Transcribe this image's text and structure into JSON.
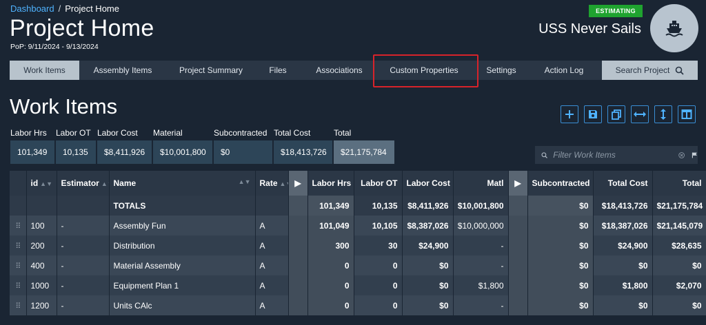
{
  "breadcrumb": {
    "home": "Dashboard",
    "separator": "/",
    "current": "Project Home"
  },
  "page": {
    "title": "Project Home",
    "pop": "PoP: 9/11/2024 - 9/13/2024"
  },
  "project": {
    "status": "ESTIMATING",
    "name": "USS Never Sails",
    "status_color": "#1fa32f",
    "avatar_icon": "ship-icon"
  },
  "tabs": [
    "Work Items",
    "Assembly Items",
    "Project Summary",
    "Files",
    "Associations",
    "Custom Properties",
    "Settings",
    "Action Log"
  ],
  "search_tab": {
    "label": "Search Project",
    "icon": "search-icon"
  },
  "section": {
    "title": "Work Items"
  },
  "toolbar": {
    "icons": [
      "add-icon",
      "save-icon",
      "copy-icon",
      "expand-horizontal-icon",
      "expand-vertical-icon",
      "columns-icon"
    ]
  },
  "summary": {
    "labels": [
      "Labor Hrs",
      "Labor OT",
      "Labor Cost",
      "Material",
      "Subcontracted",
      "Total Cost",
      "Total"
    ],
    "values": [
      "101,349",
      "10,135",
      "$8,411,926",
      "$10,001,800",
      "$0",
      "$18,413,726",
      "$21,175,784"
    ]
  },
  "filter": {
    "placeholder": "Filter Work Items"
  },
  "grid": {
    "headers": {
      "id": "id",
      "estimator": "Estimator",
      "name": "Name",
      "rate": "Rate",
      "labor_hrs": "Labor Hrs",
      "labor_ot": "Labor OT",
      "labor_cost": "Labor Cost",
      "matl": "Matl",
      "subcontracted": "Subcontracted",
      "total_cost": "Total Cost",
      "total": "Total"
    },
    "totals": {
      "label": "TOTALS",
      "labor_hrs": "101,349",
      "labor_ot": "10,135",
      "labor_cost": "$8,411,926",
      "matl": "$10,001,800",
      "subcontracted": "$0",
      "total_cost": "$18,413,726",
      "total": "$21,175,784"
    },
    "rows": [
      {
        "id": "100",
        "estimator": "-",
        "name": "Assembly Fun",
        "rate": "A",
        "labor_hrs": "101,049",
        "labor_ot": "10,105",
        "labor_cost": "$8,387,026",
        "matl": "$10,000,000",
        "subcontracted": "$0",
        "total_cost": "$18,387,026",
        "total": "$21,145,079"
      },
      {
        "id": "200",
        "estimator": "-",
        "name": "Distribution",
        "rate": "A",
        "labor_hrs": "300",
        "labor_ot": "30",
        "labor_cost": "$24,900",
        "matl": "-",
        "subcontracted": "$0",
        "total_cost": "$24,900",
        "total": "$28,635"
      },
      {
        "id": "400",
        "estimator": "-",
        "name": "Material Assembly",
        "rate": "A",
        "labor_hrs": "0",
        "labor_ot": "0",
        "labor_cost": "$0",
        "matl": "-",
        "subcontracted": "$0",
        "total_cost": "$0",
        "total": "$0"
      },
      {
        "id": "1000",
        "estimator": "-",
        "name": "Equipment Plan 1",
        "rate": "A",
        "labor_hrs": "0",
        "labor_ot": "0",
        "labor_cost": "$0",
        "matl": "$1,800",
        "subcontracted": "$0",
        "total_cost": "$1,800",
        "total": "$2,070"
      },
      {
        "id": "1200",
        "estimator": "-",
        "name": "Units CAlc",
        "rate": "A",
        "labor_hrs": "0",
        "labor_ot": "0",
        "labor_cost": "$0",
        "matl": "-",
        "subcontracted": "$0",
        "total_cost": "$0",
        "total": "$0"
      }
    ]
  }
}
